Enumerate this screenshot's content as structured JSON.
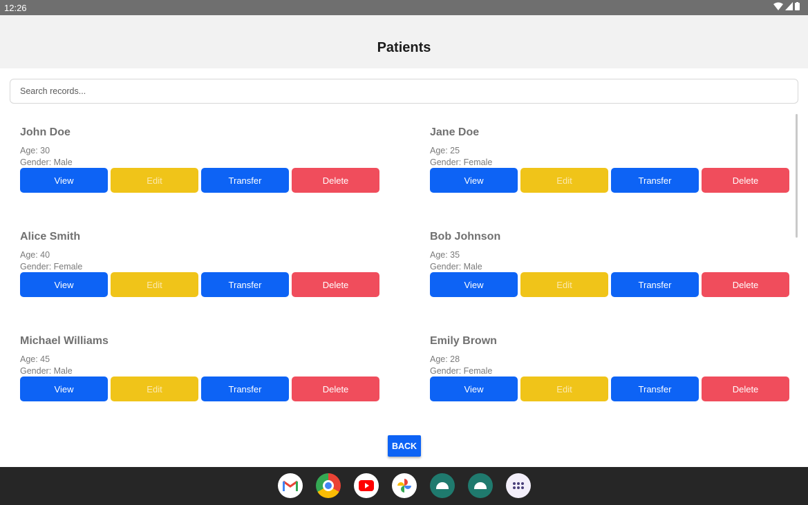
{
  "status_bar": {
    "time": "12:26"
  },
  "header": {
    "title": "Patients"
  },
  "search": {
    "placeholder": "Search records..."
  },
  "patients": [
    {
      "name": "John Doe",
      "age": "Age: 30",
      "gender": "Gender: Male"
    },
    {
      "name": "Jane Doe",
      "age": "Age: 25",
      "gender": "Gender: Female"
    },
    {
      "name": "Alice Smith",
      "age": "Age: 40",
      "gender": "Gender: Female"
    },
    {
      "name": "Bob Johnson",
      "age": "Age: 35",
      "gender": "Gender: Male"
    },
    {
      "name": "Michael Williams",
      "age": "Age: 45",
      "gender": "Gender: Male"
    },
    {
      "name": "Emily Brown",
      "age": "Age: 28",
      "gender": "Gender: Female"
    }
  ],
  "actions": {
    "view": "View",
    "edit": "Edit",
    "transfer": "Transfer",
    "delete": "Delete"
  },
  "back_label": "BACK",
  "dock_apps": [
    "gmail-icon",
    "chrome-icon",
    "youtube-icon",
    "photos-icon",
    "android-app-icon",
    "android-app-icon",
    "app-drawer-icon"
  ],
  "colors": {
    "primary": "#0d63f5",
    "edit": "#f0c419",
    "delete": "#f04d5c",
    "header": "#f2f2f2"
  }
}
